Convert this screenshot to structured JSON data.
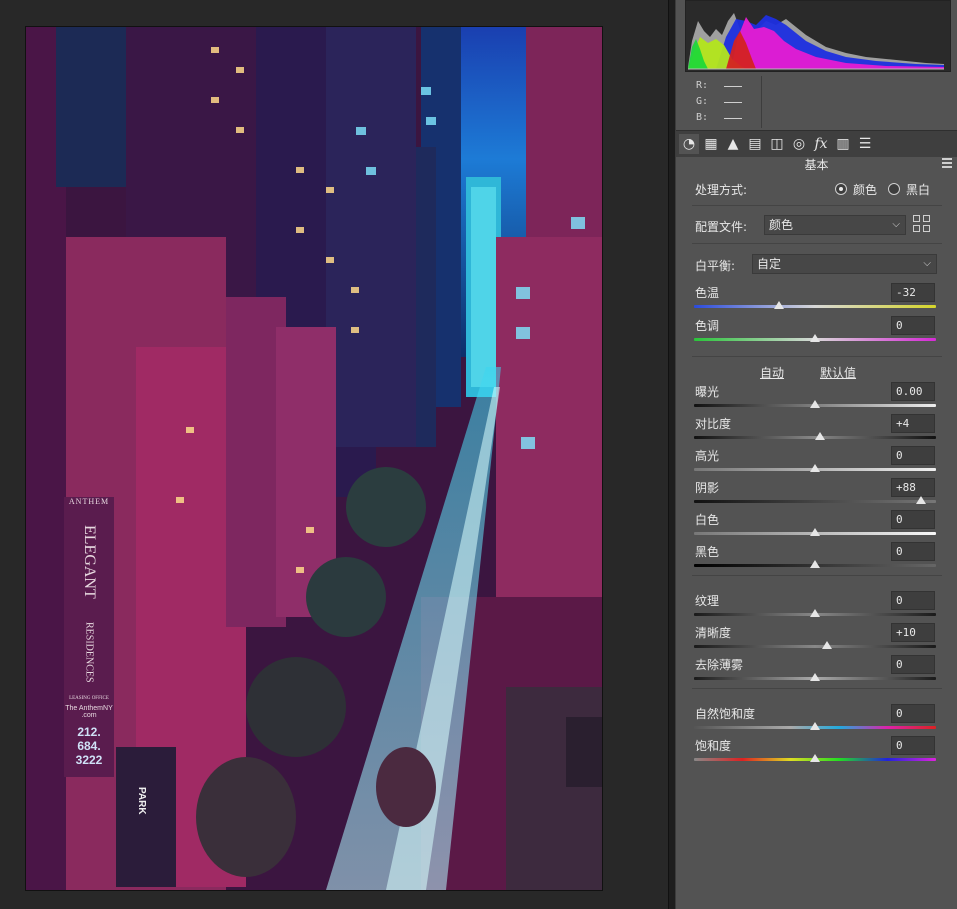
{
  "panel": {
    "rgb": [
      {
        "label": "R:"
      },
      {
        "label": "G:"
      },
      {
        "label": "B:"
      }
    ],
    "tabs": [
      "basic-tab",
      "tone-curve-tab",
      "detail-tab",
      "hsl-tab",
      "split-toning-tab",
      "lens-tab",
      "effects-tab",
      "calibration-tab",
      "presets-tab"
    ],
    "section_title": "基本",
    "treatment": {
      "label": "处理方式:",
      "options": [
        {
          "label": "颜色",
          "selected": true
        },
        {
          "label": "黑白",
          "selected": false
        }
      ]
    },
    "profile": {
      "label": "配置文件:",
      "value": "颜色"
    },
    "white_balance": {
      "label": "白平衡:",
      "value": "自定"
    },
    "links": {
      "auto": "自动",
      "default": "默认值"
    },
    "sliders": {
      "temp": {
        "label": "色温",
        "value": "-32",
        "pos": 0.35
      },
      "tint": {
        "label": "色调",
        "value": "0",
        "pos": 0.5
      },
      "exposure": {
        "label": "曝光",
        "value": "0.00",
        "pos": 0.5
      },
      "contrast": {
        "label": "对比度",
        "value": "+4",
        "pos": 0.52
      },
      "highlights": {
        "label": "高光",
        "value": "0",
        "pos": 0.5
      },
      "shadows": {
        "label": "阴影",
        "value": "+88",
        "pos": 0.94
      },
      "whites": {
        "label": "白色",
        "value": "0",
        "pos": 0.5
      },
      "blacks": {
        "label": "黑色",
        "value": "0",
        "pos": 0.5
      },
      "texture": {
        "label": "纹理",
        "value": "0",
        "pos": 0.5
      },
      "clarity": {
        "label": "清晰度",
        "value": "+10",
        "pos": 0.55
      },
      "dehaze": {
        "label": "去除薄雾",
        "value": "0",
        "pos": 0.5
      },
      "vibrance": {
        "label": "自然饱和度",
        "value": "0",
        "pos": 0.5
      },
      "saturation": {
        "label": "饱和度",
        "value": "0",
        "pos": 0.5
      }
    }
  },
  "photo": {
    "sign_brand": "ANTHEM",
    "sign_line1": "ELEGANT",
    "sign_line2": "RESIDENCES",
    "sign_small": "LEASING OFFICE",
    "sign_web": "The AnthemNY .com",
    "sign_phone": "212. 684. 3222",
    "park_sign": "PARK"
  }
}
